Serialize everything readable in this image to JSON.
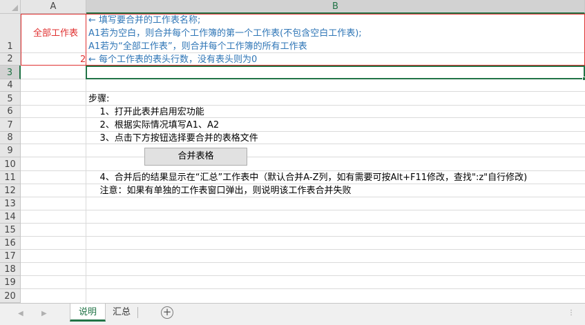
{
  "columns": [
    "A",
    "B"
  ],
  "selected_column": "B",
  "rows": [
    "1",
    "2",
    "3",
    "4",
    "5",
    "6",
    "7",
    "8",
    "9",
    "10",
    "11",
    "12",
    "13",
    "14",
    "15",
    "16",
    "17",
    "18",
    "19",
    "20"
  ],
  "selected_row": "3",
  "cells": {
    "A1": "全部工作表",
    "A2": "2",
    "B1": [
      "←  填写要合并的工作表名称;",
      "A1若为空白，则合并每个工作簿的第一个工作表(不包含空白工作表);",
      "A1若为“全部工作表”，则合并每个工作簿的所有工作表"
    ],
    "B2": "←  每个工作表的表头行数，没有表头则为0",
    "B5": "步骤:",
    "B6": "    1、打开此表并启用宏功能",
    "B7": "    2、根据实际情况填写A1、A2",
    "B8": "    3、点击下方按钮选择要合并的表格文件",
    "B11": "    4、合并后的结果显示在“汇总”工作表中（默认合并A-Z列，如有需要可按Alt+F11修改，查找\":z\"自行修改)",
    "B12": "    注意：如果有单独的工作表窗口弹出，则说明该工作表合并失败"
  },
  "button": {
    "label": "合并表格"
  },
  "sheets": [
    {
      "name": "说明",
      "active": true
    },
    {
      "name": "汇总",
      "active": false
    }
  ],
  "colors": {
    "accent": "#217346",
    "instruction_text": "#2e75b6",
    "input_text": "#e03030"
  }
}
